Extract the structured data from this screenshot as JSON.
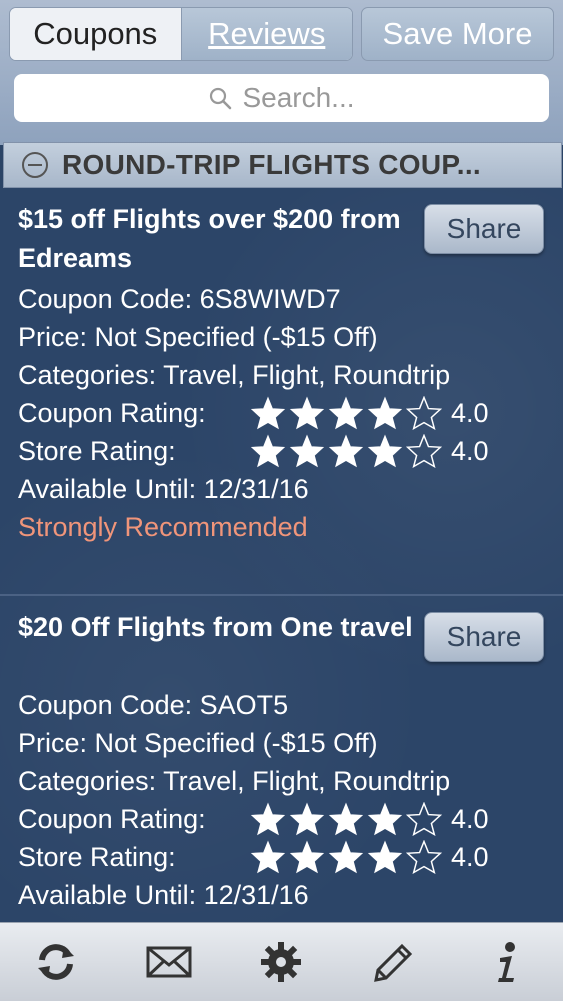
{
  "top_tabs": {
    "coupons": "Coupons",
    "reviews": "Reviews"
  },
  "save_more": "Save More",
  "search": {
    "placeholder": "Search..."
  },
  "section_title": "ROUND-TRIP FLIGHTS COUP...",
  "share_label": "Share",
  "coupons": [
    {
      "title": "$15 off Flights over $200 from Edreams",
      "code": "Coupon Code: 6S8WIWD7",
      "price": "Price: Not Specified (-$15 Off)",
      "categories": "Categories: Travel, Flight, Roundtrip",
      "coupon_rating_label": "Coupon Rating:",
      "coupon_rating": 4.0,
      "coupon_rating_text": "4.0",
      "store_rating_label": "Store Rating:",
      "store_rating": 4.0,
      "store_rating_text": "4.0",
      "available": "Available Until: 12/31/16",
      "recommendation": "Strongly Recommended"
    },
    {
      "title": "$20 Off Flights from One travel",
      "code": "Coupon Code: SAOT5",
      "price": "Price: Not Specified (-$15 Off)",
      "categories": "Categories: Travel, Flight, Roundtrip",
      "coupon_rating_label": "Coupon Rating:",
      "coupon_rating": 4.0,
      "coupon_rating_text": "4.0",
      "store_rating_label": "Store Rating:",
      "store_rating": 4.0,
      "store_rating_text": "4.0",
      "available": "Available Until: 12/31/16"
    }
  ],
  "toolbar_icons": [
    "refresh-icon",
    "mail-icon",
    "gear-icon",
    "pencil-icon",
    "info-icon"
  ],
  "colors": {
    "background": "#2c4568",
    "recommend": "#f0957a",
    "accent": "#9fb2c8"
  }
}
